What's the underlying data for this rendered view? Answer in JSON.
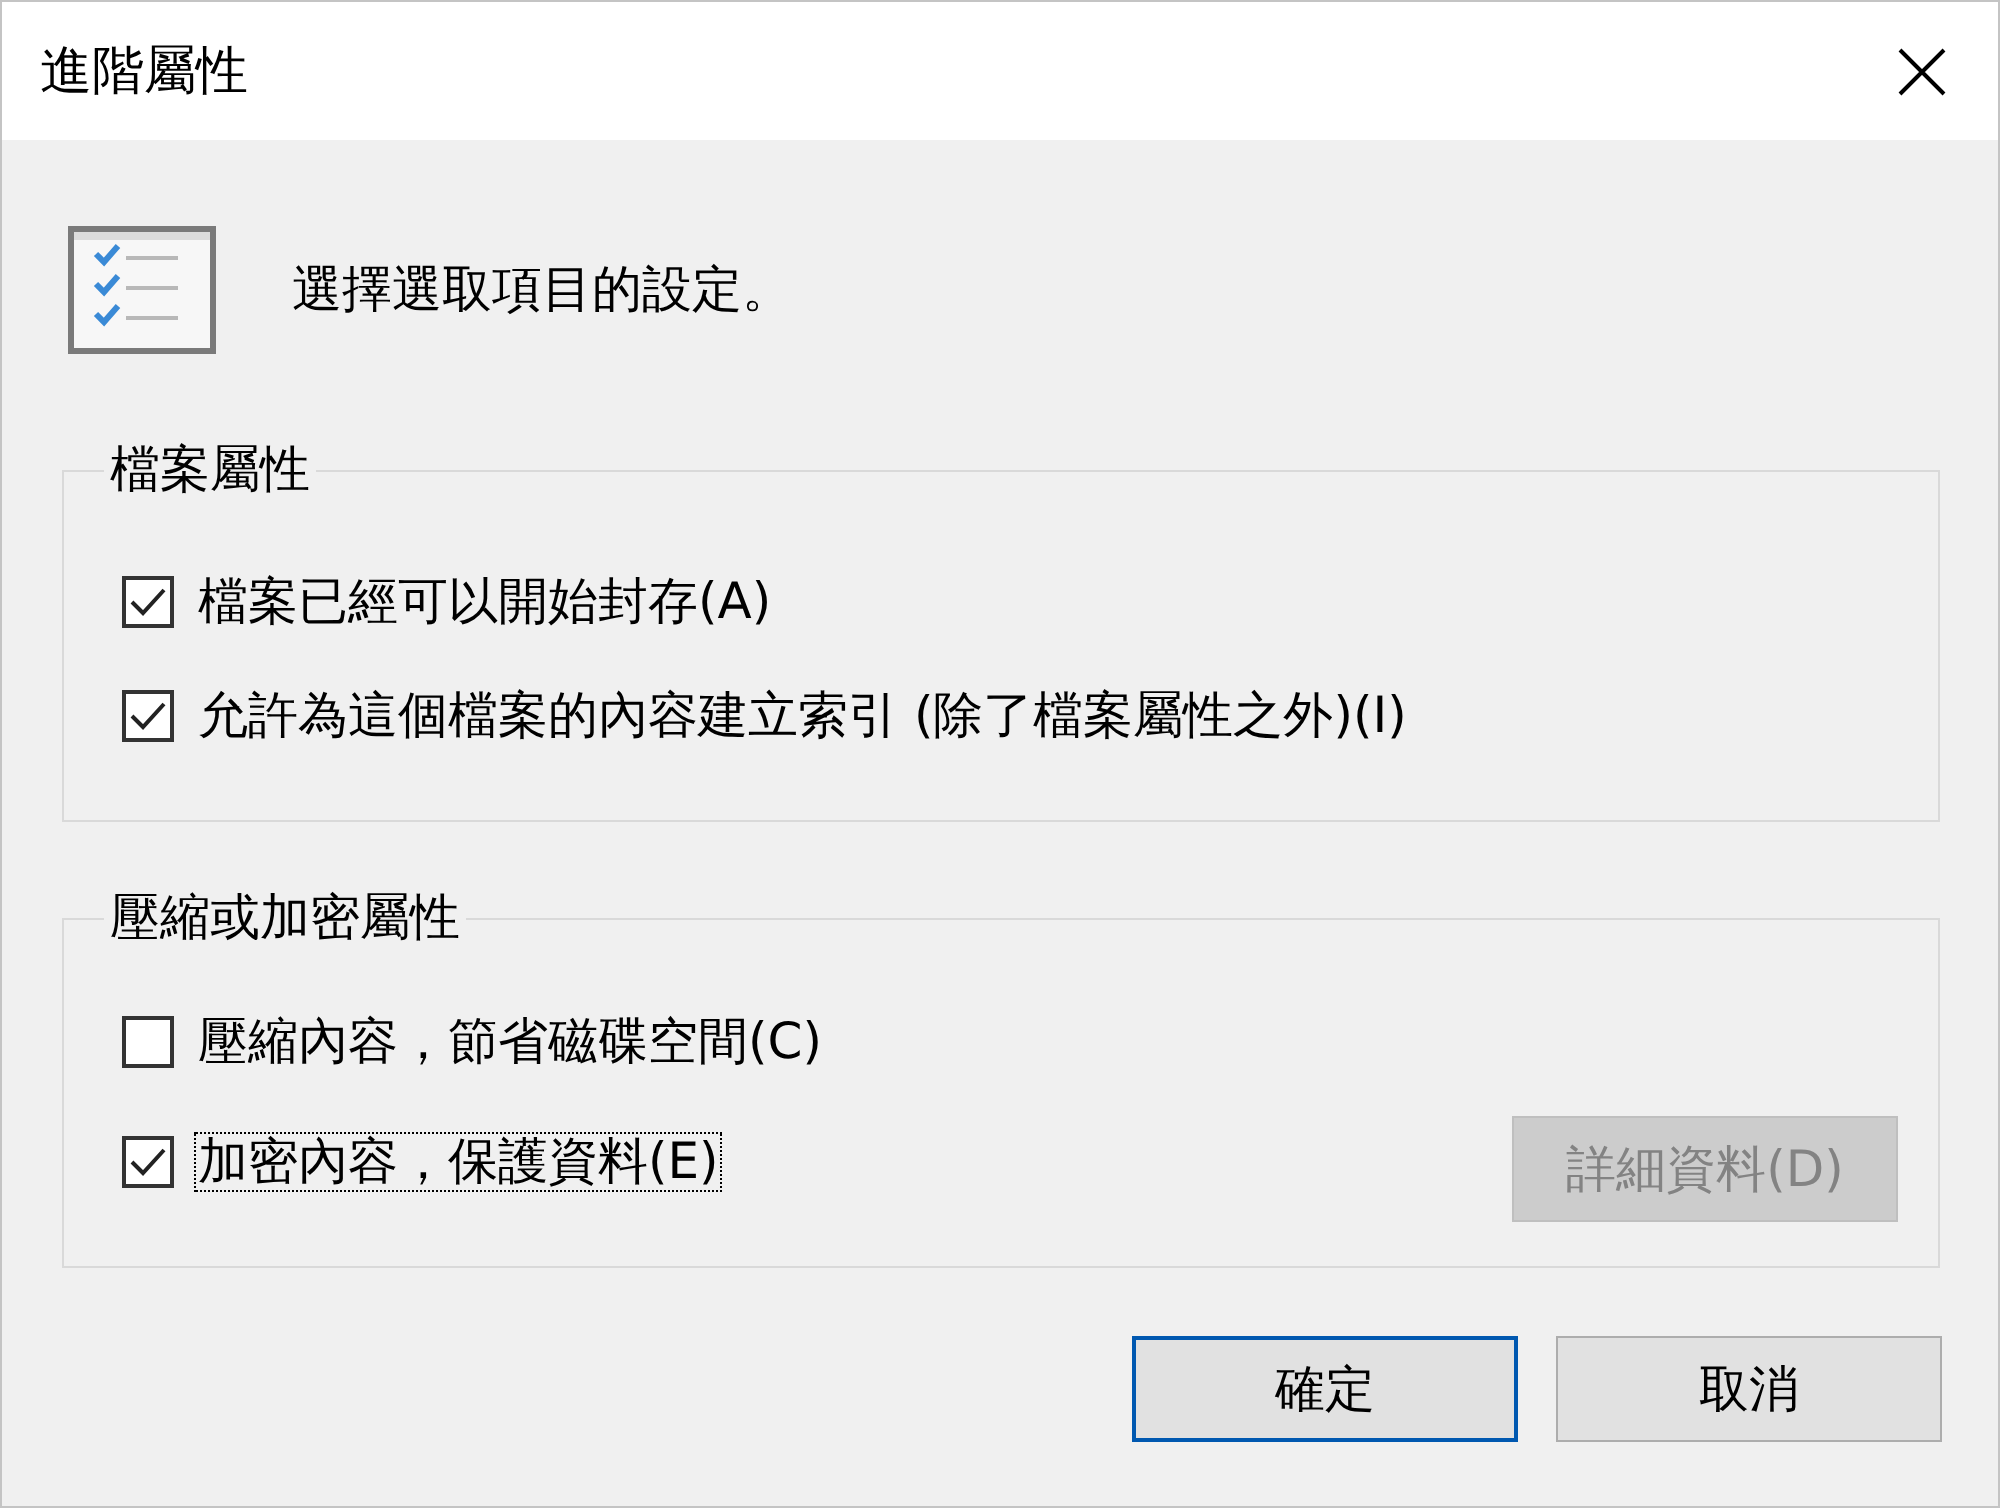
{
  "window": {
    "title": "進階屬性"
  },
  "header": {
    "text": "選擇選取項目的設定。"
  },
  "groups": [
    {
      "title": "檔案屬性",
      "options": [
        {
          "label": "檔案已經可以開始封存(A)",
          "checked": true,
          "focused": false
        },
        {
          "label": "允許為這個檔案的內容建立索引 (除了檔案屬性之外)(I)",
          "checked": true,
          "focused": false
        }
      ]
    },
    {
      "title": "壓縮或加密屬性",
      "options": [
        {
          "label": "壓縮內容，節省磁碟空間(C)",
          "checked": false,
          "focused": false
        },
        {
          "label": "加密內容，保護資料(E)",
          "checked": true,
          "focused": true
        }
      ],
      "button": {
        "label": "詳細資料(D)",
        "disabled": true
      }
    }
  ],
  "buttons": [
    {
      "label": "確定",
      "default": true
    },
    {
      "label": "取消",
      "default": false
    }
  ]
}
